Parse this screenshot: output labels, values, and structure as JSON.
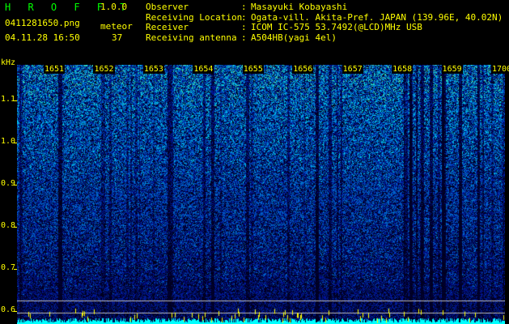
{
  "header": {
    "app_title": "H R O F F T",
    "version": "1.0.0",
    "file_name": "0411281650.png",
    "datetime": "04.11.28 16:50",
    "meteor_label": "meteor",
    "meteor_count": "37"
  },
  "info": [
    {
      "key": "Observer",
      "colon": ":",
      "value": "Masayuki Kobayashi"
    },
    {
      "key": "Receiving Location",
      "colon": ":",
      "value": "Ogata-vill. Akita-Pref. JAPAN (139.96E, 40.02N)"
    },
    {
      "key": "Receiver",
      "colon": ":",
      "value": "ICOM IC-575 53.7492(@LCD)MHz USB"
    },
    {
      "key": "Receiving antenna",
      "colon": ":",
      "value": "A504HB(yagi 4el)"
    }
  ],
  "axis": {
    "y_unit": "kHz",
    "y_ticks": [
      {
        "label": "1.1",
        "value": 1.1
      },
      {
        "label": "1.0",
        "value": 1.0
      },
      {
        "label": "0.9",
        "value": 0.9
      },
      {
        "label": "0.8",
        "value": 0.8
      },
      {
        "label": "0.7",
        "value": 0.7
      },
      {
        "label": "0.6",
        "value": 0.6
      }
    ],
    "y_range": [
      0.57,
      1.185
    ],
    "x_ticks": [
      "1651",
      "1652",
      "1653",
      "1654",
      "1655",
      "1656",
      "1657",
      "1658",
      "1659",
      "1700"
    ]
  },
  "colors": {
    "text_yellow": "#ffff00",
    "title_green": "#00ff00",
    "spectrum_cyan": "#00ffff",
    "background": "#000000"
  }
}
